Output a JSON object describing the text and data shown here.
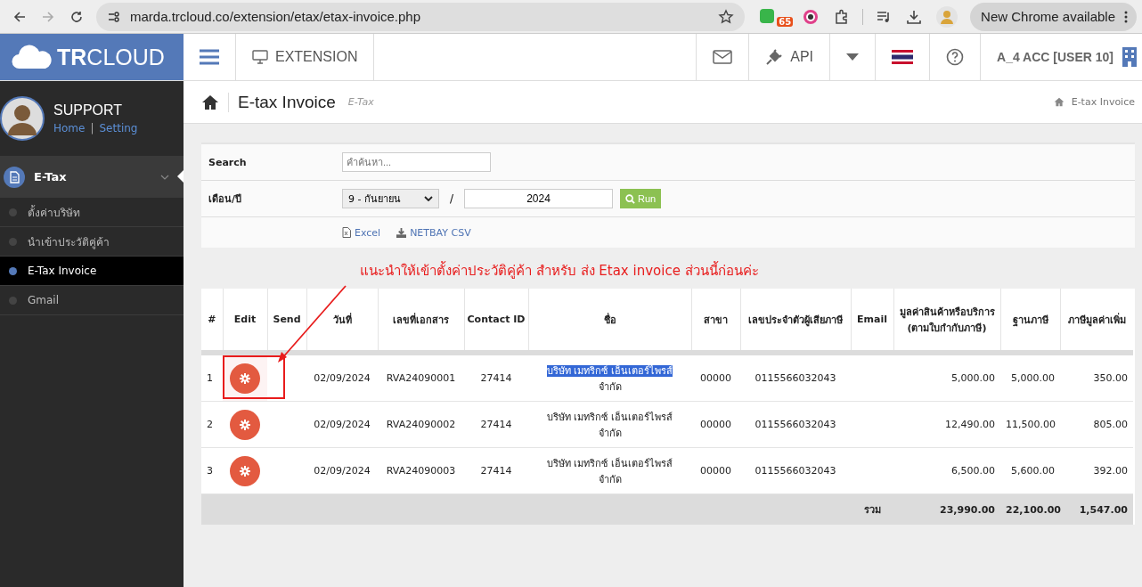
{
  "browser": {
    "url": "marda.trcloud.co/extension/etax/etax-invoice.php",
    "badge": "65",
    "update_button": "New Chrome available"
  },
  "header": {
    "logo": "**TR**CLOUD",
    "nav_item": "EXTENSION",
    "api": "API",
    "user": "A_4 ACC [USER 10]"
  },
  "sidebar": {
    "user_name": "SUPPORT",
    "links": [
      "Home",
      "Setting"
    ],
    "link_separator": "|",
    "menu": {
      "label": "E-Tax",
      "expanded": true,
      "children": [
        {
          "label": "ตั้งค่าบริษัท",
          "selected": false
        },
        {
          "label": "นำเข้าประวัติคู่ค้า",
          "selected": false
        },
        {
          "label": "E-Tax Invoice",
          "selected": true
        },
        {
          "label": "Gmail",
          "selected": false
        }
      ]
    }
  },
  "page": {
    "title": "E-tax Invoice",
    "subtitle": "E-Tax",
    "breadcrumb": "E-tax Invoice"
  },
  "filters": {
    "search_label": "Search",
    "search_placeholder": "คำค้นหา...",
    "period_label": "เดือน/ปี",
    "month": "9 - กันยายน",
    "separator": "/",
    "year": "2024",
    "run_button": "Run",
    "exports": [
      "Excel",
      "NETBAY CSV"
    ]
  },
  "annotation": "แนะนำให้เข้าตั้งค่าประวัติคู่ค้า สำหรับ ส่ง Etax invoice ส่วนนี้ก่อนค่ะ",
  "table": {
    "columns": [
      "#",
      "Edit",
      "Send",
      "วันที่",
      "เลขที่เอกสาร",
      "Contact ID",
      "ชื่อ",
      "สาขา",
      "เลขประจำตัวผู้เสียภาษี",
      "Email",
      "มูลค่าสินค้าหรือบริการ (ตามใบกำกับภาษี)",
      "ฐานภาษี",
      "ภาษีมูลค่าเพิ่ม"
    ],
    "rows": [
      {
        "no": "1",
        "date": "02/09/2024",
        "doc_no": "RVA24090001",
        "contact_id": "27414",
        "name": "บริษัท เมทริกซ์ เอ็นเตอร์ไพรส์",
        "name_2": "จำกัด",
        "name_highlighted": true,
        "marked": true,
        "branch": "00000",
        "tax_id": "0115566032043",
        "amount": "5,000.00",
        "base": "5,000.00",
        "vat": "350.00"
      },
      {
        "no": "2",
        "date": "02/09/2024",
        "doc_no": "RVA24090002",
        "contact_id": "27414",
        "name": "บริษัท เมทริกซ์ เอ็นเตอร์ไพรส์",
        "name_2": "จำกัด",
        "name_highlighted": false,
        "marked": false,
        "branch": "00000",
        "tax_id": "0115566032043",
        "amount": "12,490.00",
        "base": "11,500.00",
        "vat": "805.00"
      },
      {
        "no": "3",
        "date": "02/09/2024",
        "doc_no": "RVA24090003",
        "contact_id": "27414",
        "name": "บริษัท เมทริกซ์ เอ็นเตอร์ไพรส์",
        "name_2": "จำกัด",
        "name_highlighted": false,
        "marked": false,
        "branch": "00000",
        "tax_id": "0115566032043",
        "amount": "6,500.00",
        "base": "5,600.00",
        "vat": "392.00"
      }
    ],
    "totals": {
      "label": "รวม",
      "amount": "23,990.00",
      "base": "22,100.00",
      "vat": "1,547.00"
    }
  }
}
